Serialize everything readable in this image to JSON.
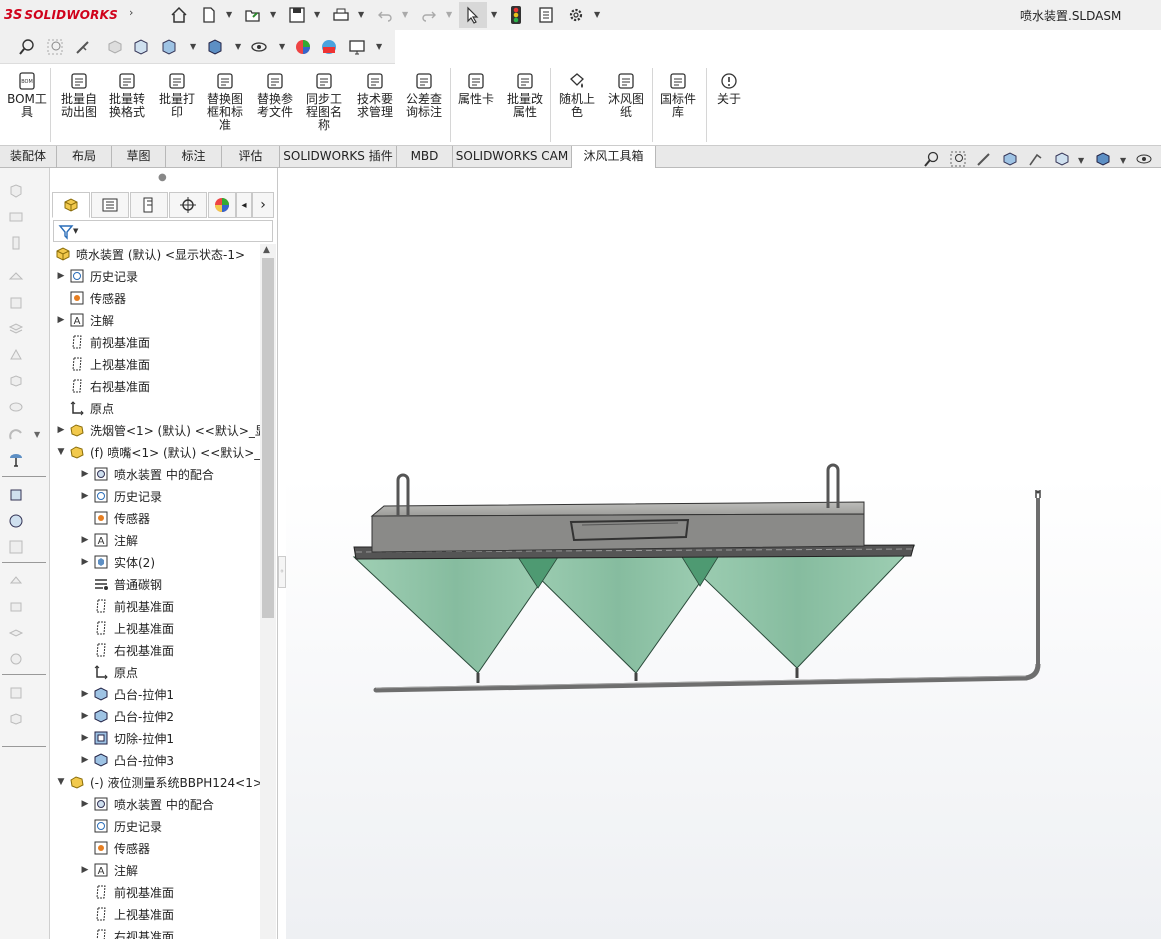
{
  "app": {
    "brand_mark": "3S",
    "brand_name": "SOLIDWORKS",
    "document_title": "喷水装置.SLDASM"
  },
  "ribbon": {
    "buttons": [
      {
        "label": "BOM工\n具",
        "icon": "bom-icon"
      },
      {
        "label": "批量自\n动出图",
        "icon": "auto-drawing-icon"
      },
      {
        "label": "批量转\n换格式",
        "icon": "convert-format-icon"
      },
      {
        "label": "批量打\n印",
        "icon": "print-icon"
      },
      {
        "label": "替换图\n框和标\n准",
        "icon": "replace-frame-icon"
      },
      {
        "label": "替换参\n考文件",
        "icon": "replace-reference-icon"
      },
      {
        "label": "同步工\n程图名\n称",
        "icon": "sync-name-icon"
      },
      {
        "label": "技术要\n求管理",
        "icon": "tech-requirements-icon"
      },
      {
        "label": "公差查\n询标注",
        "icon": "tolerance-icon"
      },
      {
        "label": "属性卡",
        "icon": "property-card-icon"
      },
      {
        "label": "批量改\n属性",
        "icon": "batch-property-icon"
      },
      {
        "label": "随机上\n色",
        "icon": "random-color-icon"
      },
      {
        "label": "沐风图\n纸",
        "icon": "mufeng-drawing-icon"
      },
      {
        "label": "国标件\n库",
        "icon": "standard-parts-icon"
      },
      {
        "label": "关于",
        "icon": "info-icon"
      }
    ]
  },
  "tabs": [
    {
      "label": "装配体"
    },
    {
      "label": "布局"
    },
    {
      "label": "草图"
    },
    {
      "label": "标注"
    },
    {
      "label": "评估"
    },
    {
      "label": "SOLIDWORKS 插件"
    },
    {
      "label": "MBD"
    },
    {
      "label": "SOLIDWORKS CAM"
    },
    {
      "label": "沐风工具箱"
    }
  ],
  "active_tab": "沐风工具箱",
  "tree": [
    {
      "label": "喷水装置 (默认) <显示状态-1>",
      "indent": 0,
      "toggle": "",
      "icon": "assembly-icon"
    },
    {
      "label": "历史记录",
      "indent": 1,
      "toggle": "▶",
      "icon": "history-icon"
    },
    {
      "label": "传感器",
      "indent": 1,
      "toggle": "",
      "icon": "sensor-icon"
    },
    {
      "label": "注解",
      "indent": 1,
      "toggle": "▶",
      "icon": "annotation-icon"
    },
    {
      "label": "前视基准面",
      "indent": 1,
      "toggle": "",
      "icon": "plane-icon"
    },
    {
      "label": "上视基准面",
      "indent": 1,
      "toggle": "",
      "icon": "plane-icon"
    },
    {
      "label": "右视基准面",
      "indent": 1,
      "toggle": "",
      "icon": "plane-icon"
    },
    {
      "label": "原点",
      "indent": 1,
      "toggle": "",
      "icon": "origin-icon"
    },
    {
      "label": "洗烟管<1> (默认) <<默认>_显",
      "indent": 1,
      "toggle": "▶",
      "icon": "part-icon"
    },
    {
      "label": "(f) 喷嘴<1> (默认) <<默认>_",
      "indent": 1,
      "toggle": "▼",
      "icon": "part-icon"
    },
    {
      "label": "喷水装置 中的配合",
      "indent": 2,
      "toggle": "▶",
      "icon": "mates-icon"
    },
    {
      "label": "历史记录",
      "indent": 2,
      "toggle": "▶",
      "icon": "history-icon"
    },
    {
      "label": "传感器",
      "indent": 2,
      "toggle": "",
      "icon": "sensor-icon"
    },
    {
      "label": "注解",
      "indent": 2,
      "toggle": "▶",
      "icon": "annotation-icon"
    },
    {
      "label": "实体(2)",
      "indent": 2,
      "toggle": "▶",
      "icon": "solid-bodies-icon"
    },
    {
      "label": "普通碳钢",
      "indent": 2,
      "toggle": "",
      "icon": "material-icon"
    },
    {
      "label": "前视基准面",
      "indent": 2,
      "toggle": "",
      "icon": "plane-icon"
    },
    {
      "label": "上视基准面",
      "indent": 2,
      "toggle": "",
      "icon": "plane-icon"
    },
    {
      "label": "右视基准面",
      "indent": 2,
      "toggle": "",
      "icon": "plane-icon"
    },
    {
      "label": "原点",
      "indent": 2,
      "toggle": "",
      "icon": "origin-icon"
    },
    {
      "label": "凸台-拉伸1",
      "indent": 2,
      "toggle": "▶",
      "icon": "extrude-icon"
    },
    {
      "label": "凸台-拉伸2",
      "indent": 2,
      "toggle": "▶",
      "icon": "extrude-icon"
    },
    {
      "label": "切除-拉伸1",
      "indent": 2,
      "toggle": "▶",
      "icon": "cut-extrude-icon"
    },
    {
      "label": "凸台-拉伸3",
      "indent": 2,
      "toggle": "▶",
      "icon": "extrude-icon"
    },
    {
      "label": "(-) 液位测量系统BBPH124<1>",
      "indent": 1,
      "toggle": "▼",
      "icon": "part-icon"
    },
    {
      "label": "喷水装置 中的配合",
      "indent": 2,
      "toggle": "▶",
      "icon": "mates-icon"
    },
    {
      "label": "历史记录",
      "indent": 2,
      "toggle": "",
      "icon": "history-icon"
    },
    {
      "label": "传感器",
      "indent": 2,
      "toggle": "",
      "icon": "sensor-icon"
    },
    {
      "label": "注解",
      "indent": 2,
      "toggle": "▶",
      "icon": "annotation-icon"
    },
    {
      "label": "前视基准面",
      "indent": 2,
      "toggle": "",
      "icon": "plane-icon"
    },
    {
      "label": "上视基准面",
      "indent": 2,
      "toggle": "",
      "icon": "plane-icon"
    },
    {
      "label": "右视基准面",
      "indent": 2,
      "toggle": "",
      "icon": "plane-icon"
    }
  ],
  "colors": {
    "accent": "#d0021b",
    "cone": "#8fc4a8",
    "cone_dark": "#4e9a72",
    "tank": "#8a8a88",
    "pipe": "#6e6e6e"
  }
}
